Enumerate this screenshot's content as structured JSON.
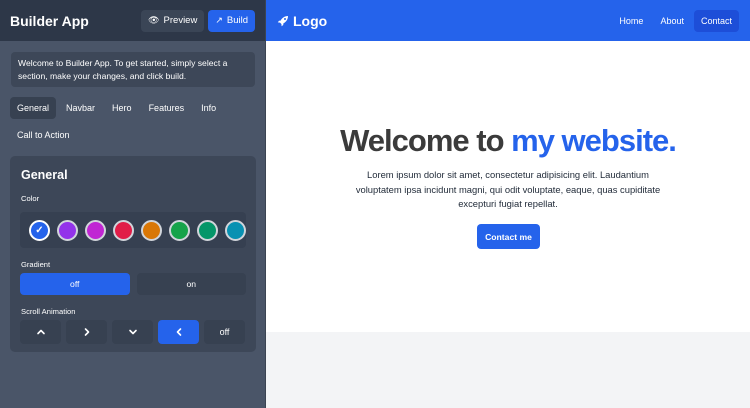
{
  "builder": {
    "title": "Builder App",
    "preview_label": "Preview",
    "build_label": "Build",
    "welcome": "Welcome to Builder App. To get started, simply select a section, make your changes, and click build.",
    "tabs": [
      {
        "label": "General",
        "active": true
      },
      {
        "label": "Navbar",
        "active": false
      },
      {
        "label": "Hero",
        "active": false
      },
      {
        "label": "Features",
        "active": false
      },
      {
        "label": "Info",
        "active": false
      },
      {
        "label": "Call to Action",
        "active": false
      }
    ],
    "panel": {
      "title": "General",
      "color_label": "Color",
      "colors": [
        "#2563eb",
        "#9333ea",
        "#c026d3",
        "#e11d48",
        "#d97706",
        "#16a34a",
        "#059669",
        "#0891b2"
      ],
      "selected_color_index": 0,
      "gradient_label": "Gradient",
      "gradient_options": [
        "off",
        "on"
      ],
      "gradient_selected": "off",
      "scroll_label": "Scroll Animation",
      "scroll_options": [
        "chevron-up-icon",
        "chevron-right-icon",
        "chevron-down-icon",
        "chevron-left-icon",
        "off"
      ],
      "scroll_off_label": "off",
      "scroll_selected_index": 3
    }
  },
  "site": {
    "logo": "Logo",
    "nav": [
      {
        "label": "Home",
        "active": false
      },
      {
        "label": "About",
        "active": false
      },
      {
        "label": "Contact",
        "active": true
      }
    ],
    "hero": {
      "title_main": "Welcome to ",
      "title_accent": "my website.",
      "text": "Lorem ipsum dolor sit amet, consectetur adipisicing elit. Laudantium voluptatem ipsa incidunt magni, qui odit voluptate, eaque, quas cupiditate excepturi fugiat repellat.",
      "button": "Contact me"
    },
    "accent_color": "#2563eb"
  }
}
